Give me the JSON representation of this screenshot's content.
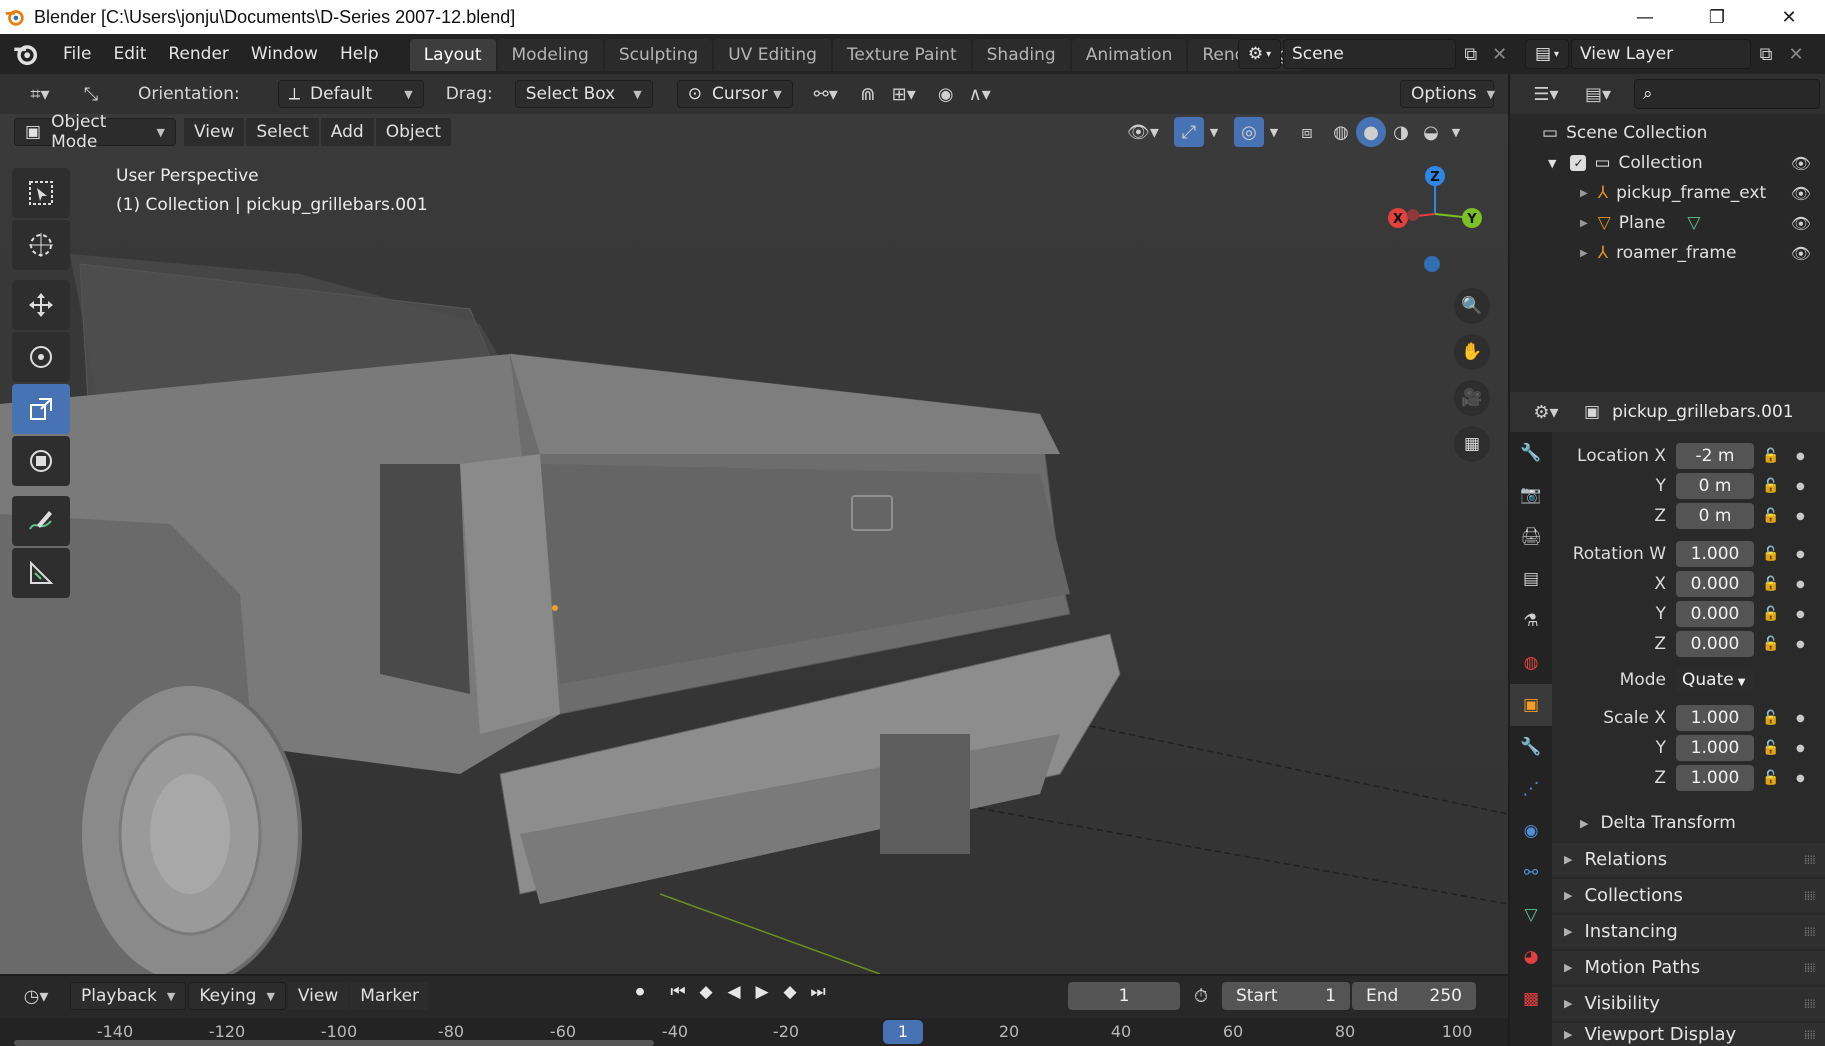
{
  "window": {
    "title": "Blender [C:\\Users\\jonju\\Documents\\D-Series 2007-12.blend]",
    "controls": [
      "—",
      "❐",
      "✕"
    ]
  },
  "menu": [
    "File",
    "Edit",
    "Render",
    "Window",
    "Help"
  ],
  "workspaces": [
    {
      "label": "Layout",
      "active": true
    },
    {
      "label": "Modeling"
    },
    {
      "label": "Sculpting"
    },
    {
      "label": "UV Editing"
    },
    {
      "label": "Texture Paint"
    },
    {
      "label": "Shading"
    },
    {
      "label": "Animation"
    },
    {
      "label": "Rendering"
    }
  ],
  "scene": {
    "name": "Scene"
  },
  "view_layer": {
    "name": "View Layer"
  },
  "tool_header": {
    "orientation_label": "Orientation:",
    "orientation_value": "Default",
    "drag_label": "Drag:",
    "drag_value": "Select Box",
    "pivot_value": "Cursor",
    "options_label": "Options"
  },
  "viewport_header": {
    "mode": "Object Mode",
    "menus": [
      "View",
      "Select",
      "Add",
      "Object"
    ]
  },
  "viewport_overlay": {
    "perspective": "User Perspective",
    "info": "(1) Collection | pickup_grillebars.001"
  },
  "gizmo": {
    "x_label": "X",
    "y_label": "Y",
    "z_label": "Z"
  },
  "outliner": {
    "scene_collection": "Scene Collection",
    "collection": "Collection",
    "items": [
      "pickup_frame_ext",
      "Plane",
      "roamer_frame"
    ]
  },
  "properties": {
    "object_name": "pickup_grillebars.001",
    "location": {
      "label_x": "Location X",
      "label_y": "Y",
      "label_z": "Z",
      "x": "-2 m",
      "y": "0 m",
      "z": "0 m"
    },
    "rotation": {
      "label_w": "Rotation W",
      "label_x": "X",
      "label_y": "Y",
      "label_z": "Z",
      "w": "1.000",
      "x": "0.000",
      "y": "0.000",
      "z": "0.000"
    },
    "mode": {
      "label": "Mode",
      "value": "Quate"
    },
    "scale": {
      "label_x": "Scale X",
      "label_y": "Y",
      "label_z": "Z",
      "x": "1.000",
      "y": "1.000",
      "z": "1.000"
    },
    "panels": [
      "Delta Transform",
      "Relations",
      "Collections",
      "Instancing",
      "Motion Paths",
      "Visibility",
      "Viewport Display"
    ]
  },
  "timeline": {
    "menus": [
      "Playback",
      "Keying",
      "View",
      "Marker"
    ],
    "current_frame": "1",
    "start_label": "Start",
    "start_value": "1",
    "end_label": "End",
    "end_value": "250",
    "ruler_ticks": [
      "-140",
      "-120",
      "-100",
      "-80",
      "-60",
      "-40",
      "-20",
      "1",
      "20",
      "40",
      "60",
      "80",
      "100"
    ]
  },
  "colors": {
    "accent": "#4772b3",
    "axis_x": "#e34040",
    "axis_y": "#7bc123",
    "axis_z": "#2f86e6"
  }
}
